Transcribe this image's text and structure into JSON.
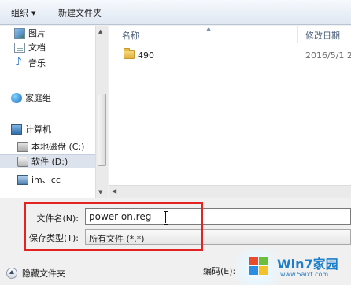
{
  "toolbar": {
    "organize_label": "组织",
    "organize_arrow": "▼",
    "new_folder_label": "新建文件夹"
  },
  "nav": {
    "items": [
      {
        "label": "图片",
        "icon": "pictures-icon"
      },
      {
        "label": "文档",
        "icon": "documents-icon"
      },
      {
        "label": "音乐",
        "icon": "music-icon"
      },
      {
        "label": "家庭组",
        "icon": "homegroup-icon"
      },
      {
        "label": "计算机",
        "icon": "computer-icon"
      },
      {
        "label": "本地磁盘 (C:)",
        "icon": "local-disk-icon"
      },
      {
        "label": "软件 (D:)",
        "icon": "drive-icon",
        "selected": true
      },
      {
        "label": "im、cc",
        "icon": "network-drive-icon"
      }
    ]
  },
  "file_list": {
    "columns": {
      "name": "名称",
      "date_modified": "修改日期"
    },
    "sort_indicator": "▲",
    "rows": [
      {
        "name": "490",
        "date_modified": "2016/5/1 2",
        "icon": "folder-icon"
      }
    ]
  },
  "form": {
    "filename_label": "文件名(N):",
    "filename_value": "power on.reg",
    "filetype_label": "保存类型(T):",
    "filetype_value": "所有文件  (*.*)"
  },
  "bottom": {
    "hide_folders_label": "隐藏文件夹",
    "encoding_label": "编码(E):"
  },
  "watermark": {
    "title": "Win7家园",
    "url": "www.5aixt.com"
  },
  "colors": {
    "highlight": "#e32222",
    "toolbar_top": "#f6f9fd",
    "toolbar_bottom": "#dfe7f2",
    "selected_bg": "#dde3ec"
  }
}
